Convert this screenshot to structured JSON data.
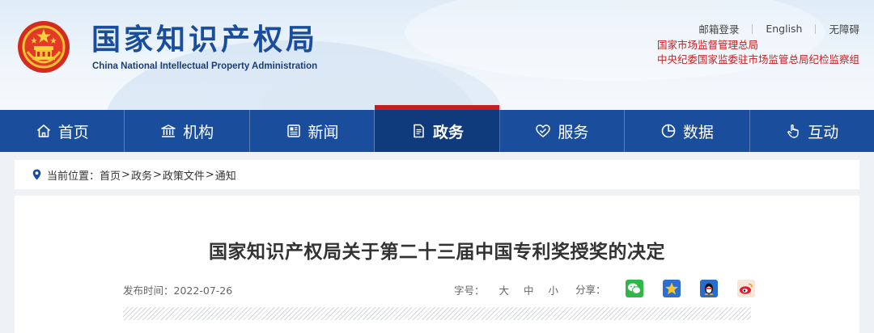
{
  "header": {
    "logo_cn": "国家知识产权局",
    "logo_en": "China National Intellectual Property Administration",
    "top_links": [
      "邮箱登录",
      "English",
      "无障碍"
    ],
    "orgs": [
      "国家市场监督管理总局",
      "中央纪委国家监委驻市场监管总局纪检监察组"
    ]
  },
  "nav": {
    "items": [
      {
        "label": "首页",
        "icon": "home-icon"
      },
      {
        "label": "机构",
        "icon": "institution-icon"
      },
      {
        "label": "新闻",
        "icon": "news-icon"
      },
      {
        "label": "政务",
        "icon": "document-icon",
        "active": true
      },
      {
        "label": "服务",
        "icon": "service-icon"
      },
      {
        "label": "数据",
        "icon": "data-pie-icon"
      },
      {
        "label": "互动",
        "icon": "interact-hand-icon"
      }
    ]
  },
  "breadcrumb": {
    "prefix": "当前位置：",
    "items": [
      "首页",
      "政务",
      "政策文件",
      "通知"
    ],
    "separator": ">"
  },
  "article": {
    "title": "国家知识产权局关于第二十三届中国专利奖授奖的决定",
    "publish_label": "发布时间：",
    "publish_date": "2022-07-26",
    "font_label": "字号：",
    "font_sizes": [
      "大",
      "中",
      "小"
    ],
    "share_label": "分享：",
    "share_targets": [
      "wechat-icon",
      "qzone-star-icon",
      "qq-penguin-icon",
      "weibo-icon"
    ]
  },
  "colors": {
    "brand_blue": "#1a4e9d",
    "active_nav": "#0f3a7b",
    "accent_red": "#c61f1f"
  }
}
